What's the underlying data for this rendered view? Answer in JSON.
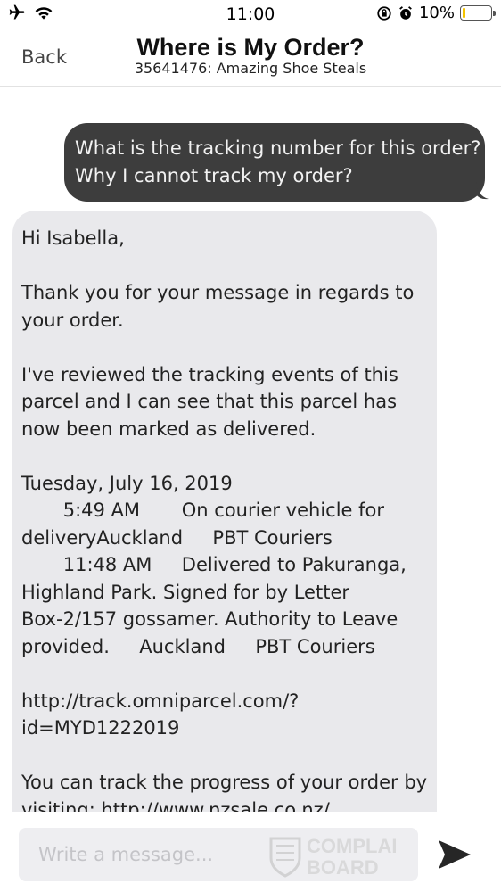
{
  "status_bar": {
    "time": "11:00",
    "battery_percent_label": "10%",
    "battery_level": 0.1,
    "icons": [
      "airplane-icon",
      "wifi-icon",
      "rotation-lock-icon",
      "alarm-icon",
      "battery-icon"
    ]
  },
  "nav": {
    "back_label": "Back",
    "title": "Where is My Order?",
    "subtitle": "35641476: Amazing Shoe Steals"
  },
  "messages": {
    "outgoing": {
      "lines": [
        "What is the tracking number for this order?",
        "Why I cannot track my order?"
      ]
    },
    "incoming": {
      "greeting": "Hi Isabella,",
      "para1": [
        "Thank you for your message in regards to",
        "your order."
      ],
      "para2": [
        "I've reviewed the tracking events of this",
        "parcel and I can see that this parcel has",
        "now been marked as delivered."
      ],
      "events": [
        "Tuesday, July 16, 2019",
        "       5:49 AM       On courier vehicle for",
        "deliveryAuckland     PBT Couriers",
        "       11:48 AM     Delivered to Pakuranga,",
        "Highland Park. Signed for by Letter",
        "Box-2/157 gossamer. Authority to Leave",
        "provided.     Auckland     PBT Couriers"
      ],
      "link": [
        "http://track.omniparcel.com/?",
        "id=MYD1222019"
      ],
      "para3": [
        "You can track the progress of your order by",
        "visiting: http://www.nzsale.co.nz/"
      ]
    }
  },
  "composer": {
    "placeholder": "Write a message...",
    "send_icon": "send-icon"
  },
  "watermark": {
    "text_line1": "COMPLAI",
    "text_line2": "BOARD"
  },
  "colors": {
    "outgoing_bubble": "#3d3d3d",
    "incoming_bubble": "#e9e9ec",
    "battery_fill": "#f5c400",
    "input_bg": "#eeeef1"
  }
}
